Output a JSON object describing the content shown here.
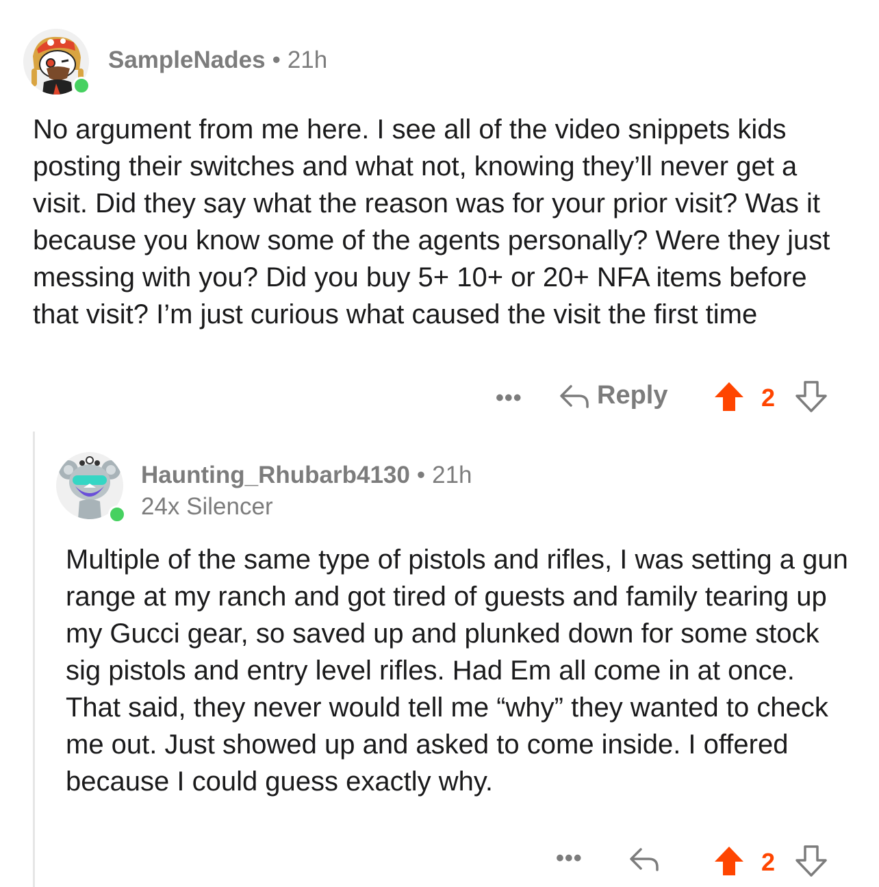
{
  "comments": [
    {
      "username": "SampleNades",
      "separator": "•",
      "age": "21h",
      "body": "No argument from me here. I see all of the video snippets kids posting their switches and what not, knowing they’ll never get a visit. Did they say what the reason was for your prior visit? Was it because you know some of the agents personally? Were they just messing with you? Did you buy 5+ 10+ or 20+ NFA items before that visit? I’m just curious what caused the visit the first time",
      "more_label": "•••",
      "reply_label": "Reply",
      "score": "2",
      "upvoted": true,
      "online": true,
      "avatar_icon": "snoo-avatar-icon"
    },
    {
      "username": "Haunting_Rhubarb4130",
      "separator": "•",
      "age": "21h",
      "flair": "24x Silencer",
      "body": "Multiple of the same type of pistols and rifles, I was setting a gun range at my ranch and got tired of guests and family tearing up my Gucci gear, so saved up and plunked down for some stock sig pistols and entry level rifles. Had Em all come in at once. That said, they never would tell me “why” they wanted to check me out. Just showed up and asked to come inside. I offered because I could guess exactly why.",
      "more_label": "•••",
      "score": "2",
      "upvoted": true,
      "online": true,
      "avatar_icon": "koala-avatar-icon"
    }
  ],
  "colors": {
    "upvote": "#ff4500",
    "meta": "#7c7c7c",
    "text": "#1a1a1b",
    "online": "#46d160",
    "thread_line": "#e6e6e6"
  }
}
